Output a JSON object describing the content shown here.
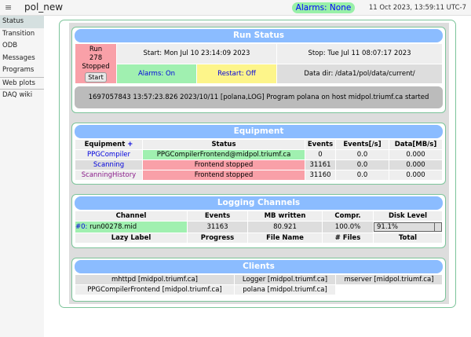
{
  "header": {
    "menu_icon": "≡",
    "title": "pol_new",
    "alarms": "Alarms: None",
    "clock": "11 Oct 2023, 13:59:11 UTC-7"
  },
  "sidebar": {
    "items": [
      {
        "label": "Status"
      },
      {
        "label": "Transition"
      },
      {
        "label": "ODB"
      },
      {
        "label": "Messages"
      },
      {
        "label": "Programs"
      },
      {
        "label": "Web plots"
      },
      {
        "label": "DAQ wiki"
      }
    ]
  },
  "run_status": {
    "title": "Run Status",
    "run_label": "Run",
    "run_number": "278",
    "state": "Stopped",
    "start_button": "Start",
    "start": "Start: Mon Jul 10 23:14:09 2023",
    "stop": "Stop: Tue Jul 11 08:07:17 2023",
    "alarms": "Alarms: On",
    "restart": "Restart: Off",
    "data_dir": "Data dir: /data1/pol/data/current/",
    "message": "1697057843 13:57:23.826 2023/10/11 [polana,LOG] Program polana on host midpol.triumf.ca started"
  },
  "equipment": {
    "title": "Equipment",
    "headers": [
      "Equipment",
      "Status",
      "Events",
      "Events[/s]",
      "Data[MB/s]"
    ],
    "add": "+",
    "rows": [
      {
        "name": "PPGCompiler",
        "status": "PPGCompilerFrontend@midpol.triumf.ca",
        "events": "0",
        "rate": "0.0",
        "data": "0.000"
      },
      {
        "name": "Scanning",
        "status": "Frontend stopped",
        "events": "31161",
        "rate": "0.0",
        "data": "0.000"
      },
      {
        "name": "ScanningHistory",
        "status": "Frontend stopped",
        "events": "31160",
        "rate": "0.0",
        "data": "0.000"
      }
    ]
  },
  "logging": {
    "title": "Logging Channels",
    "headers": [
      "Channel",
      "Events",
      "MB written",
      "Compr.",
      "Disk Level"
    ],
    "channel_id": "#0:",
    "channel_file": "run00278.mid",
    "events": "31163",
    "mb": "80.921",
    "compr": "100.0%",
    "disk": "91.1%",
    "disk_level": 0.911,
    "headers2": [
      "Lazy Label",
      "Progress",
      "File Name",
      "# Files",
      "Total"
    ]
  },
  "clients": {
    "title": "Clients",
    "items": [
      "mhttpd [midpol.triumf.ca]",
      "Logger [midpol.triumf.ca]",
      "mserver [midpol.triumf.ca]",
      "PPGCompilerFrontend [midpol.triumf.ca]",
      "polana [midpol.triumf.ca]"
    ]
  }
}
